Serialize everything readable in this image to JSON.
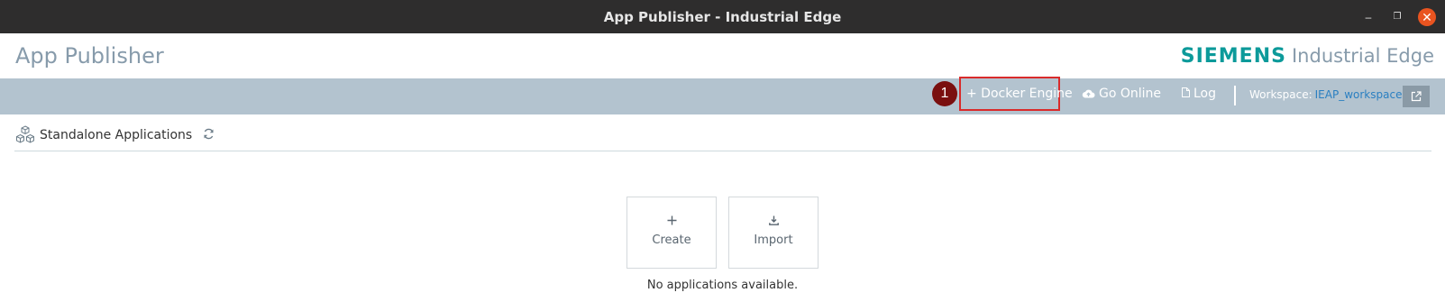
{
  "window": {
    "title": "App Publisher - Industrial Edge",
    "min_glyph": "–",
    "max_glyph": "❐",
    "close_glyph": "✕"
  },
  "app": {
    "title": "App Publisher",
    "brand_name": "SIEMENS",
    "brand_product": "Industrial Edge"
  },
  "toolbar": {
    "marker": "1",
    "docker_engine_label": "+ Docker Engine",
    "go_online_label": "Go Online",
    "log_label": "Log",
    "workspace_label": "Workspace:",
    "workspace_value": "IEAP_workspace"
  },
  "section": {
    "title": "Standalone Applications"
  },
  "actions": {
    "create_label": "Create",
    "import_label": "Import"
  },
  "empty_message": "No applications available.",
  "colors": {
    "titlebar_bg": "#2e2d2d",
    "toolbar_bg": "#b3c3cf",
    "brand_teal": "#0c9a9a",
    "marker_red": "#7a0f0f",
    "highlight_red": "#d92b2b",
    "close_orange": "#e95420",
    "link_blue": "#2a7fc1"
  },
  "icons": {
    "cloud": "cloud-upload-icon",
    "log": "document-icon",
    "refresh": "refresh-icon",
    "external": "external-link-icon",
    "apps": "cubes-icon",
    "create": "plus-icon",
    "import": "download-icon"
  }
}
